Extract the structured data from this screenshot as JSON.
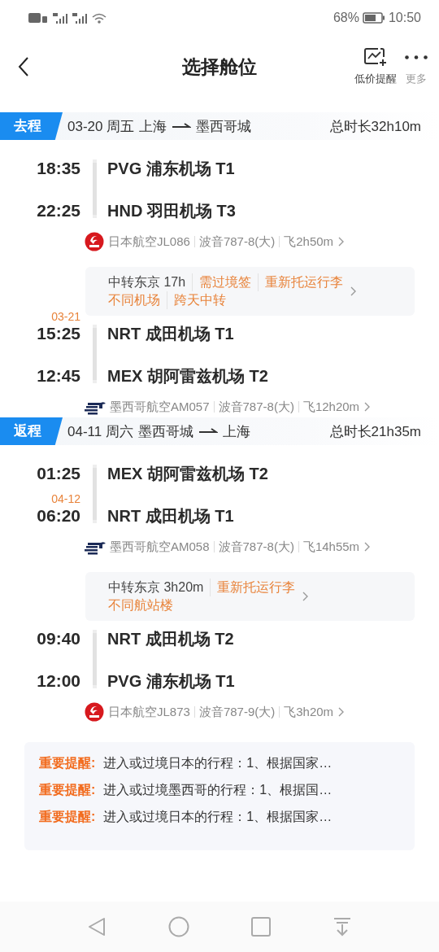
{
  "status_bar": {
    "battery": "68%",
    "time": "10:50"
  },
  "header": {
    "title": "选择舱位",
    "actions": [
      {
        "kind": "chart",
        "label": "低价提醒"
      },
      {
        "kind": "more",
        "label": "更多"
      }
    ]
  },
  "trips": [
    {
      "tag": "去程",
      "date": "03-20 周五",
      "from": "上海",
      "to": "墨西哥城",
      "duration": "总时长32h10m",
      "items": [
        {
          "kind": "flight",
          "dep_time": "18:35",
          "dep_airport": "PVG 浦东机场 T1",
          "arr_time": "22:25",
          "arr_airport": "HND 羽田机场 T3",
          "logo": {
            "kind": "crane"
          },
          "airline": "日本航空JL086",
          "aircraft": "波音787-8(大)",
          "flight_time": "飞2h50m"
        },
        {
          "kind": "transfer",
          "info": "中转东京 17h",
          "tag_lines": [
            [
              "需过境签",
              "重新托运行李"
            ],
            [
              "不同机场",
              "跨天中转"
            ]
          ]
        },
        {
          "kind": "flight",
          "dep_date": "03-21",
          "dep_time": "15:25",
          "dep_airport": "NRT 成田机场 T1",
          "arr_time": "12:45",
          "arr_airport": "MEX 胡阿雷兹机场 T2",
          "logo": {
            "kind": "eagle"
          },
          "airline": "墨西哥航空AM057",
          "aircraft": "波音787-8(大)",
          "flight_time": "飞12h20m"
        }
      ]
    },
    {
      "tag": "返程",
      "date": "04-11 周六",
      "from": "墨西哥城",
      "to": "上海",
      "duration": "总时长21h35m",
      "items": [
        {
          "kind": "flight",
          "dep_time": "01:25",
          "dep_airport": "MEX 胡阿雷兹机场 T2",
          "arr_date": "04-12",
          "arr_time": "06:20",
          "arr_airport": "NRT 成田机场 T1",
          "logo": {
            "kind": "eagle"
          },
          "airline": "墨西哥航空AM058",
          "aircraft": "波音787-8(大)",
          "flight_time": "飞14h55m"
        },
        {
          "kind": "transfer",
          "info": "中转东京 3h20m",
          "tag_lines": [
            [
              "重新托运行李"
            ],
            [
              "不同航站楼"
            ]
          ]
        },
        {
          "kind": "flight",
          "dep_time": "09:40",
          "dep_airport": "NRT 成田机场 T2",
          "arr_time": "12:00",
          "arr_airport": "PVG 浦东机场 T1",
          "logo": {
            "kind": "crane"
          },
          "airline": "日本航空JL873",
          "aircraft": "波音787-9(大)",
          "flight_time": "飞3h20m"
        }
      ]
    }
  ],
  "notices": [
    {
      "label": "重要提醒:",
      "text": "进入或过境日本的行程：1、根据国家…"
    },
    {
      "label": "重要提醒:",
      "text": "进入或过境墨西哥的行程：1、根据国…"
    },
    {
      "label": "重要提醒:",
      "text": "进入或过境日本的行程：1、根据国家…"
    }
  ]
}
